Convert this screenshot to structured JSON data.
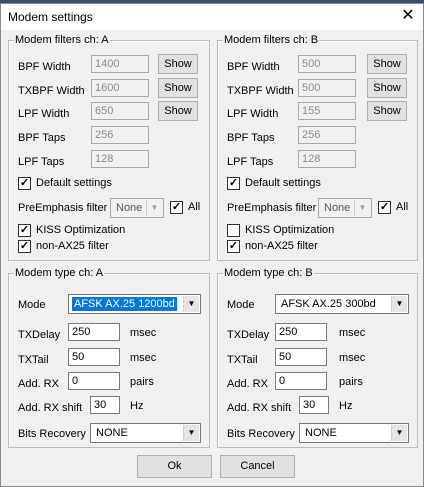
{
  "window": {
    "title": "Modem settings"
  },
  "filters_a": {
    "legend": "Modem filters ch: A",
    "bpf_width_label": "BPF Width",
    "bpf_width": "1400",
    "txbpf_width_label": "TXBPF Width",
    "txbpf_width": "1600",
    "lpf_width_label": "LPF Width",
    "lpf_width": "650",
    "bpf_taps_label": "BPF Taps",
    "bpf_taps": "256",
    "lpf_taps_label": "LPF Taps",
    "lpf_taps": "128",
    "show_label": "Show",
    "default_settings_label": "Default settings",
    "default_settings_checked": true,
    "preemphasis_label": "PreEmphasis filter",
    "preemphasis_value": "None",
    "all_label": "All",
    "all_checked": true,
    "kiss_label": "KISS Optimization",
    "kiss_checked": true,
    "nonax25_label": "non-AX25 filter",
    "nonax25_checked": true
  },
  "filters_b": {
    "legend": "Modem filters ch: B",
    "bpf_width_label": "BPF Width",
    "bpf_width": "500",
    "txbpf_width_label": "TXBPF Width",
    "txbpf_width": "500",
    "lpf_width_label": "LPF Width",
    "lpf_width": "155",
    "bpf_taps_label": "BPF Taps",
    "bpf_taps": "256",
    "lpf_taps_label": "LPF Taps",
    "lpf_taps": "128",
    "show_label": "Show",
    "default_settings_label": "Default settings",
    "default_settings_checked": true,
    "preemphasis_label": "PreEmphasis filter",
    "preemphasis_value": "None",
    "all_label": "All",
    "all_checked": true,
    "kiss_label": "KISS Optimization",
    "kiss_checked": false,
    "nonax25_label": "non-AX25 filter",
    "nonax25_checked": true
  },
  "type_a": {
    "legend": "Modem type ch: A",
    "mode_label": "Mode",
    "mode_value": "AFSK AX.25 1200bd",
    "txdelay_label": "TXDelay",
    "txdelay": "250",
    "txdelay_unit": "msec",
    "txtail_label": "TXTail",
    "txtail": "50",
    "txtail_unit": "msec",
    "addrx_label": "Add. RX",
    "addrx": "0",
    "addrx_unit": "pairs",
    "addrxshift_label": "Add. RX shift",
    "addrxshift": "30",
    "addrxshift_unit": "Hz",
    "bits_label": "Bits Recovery",
    "bits_value": "NONE"
  },
  "type_b": {
    "legend": "Modem type ch: B",
    "mode_label": "Mode",
    "mode_value": "AFSK AX.25 300bd",
    "txdelay_label": "TXDelay",
    "txdelay": "250",
    "txdelay_unit": "msec",
    "txtail_label": "TXTail",
    "txtail": "50",
    "txtail_unit": "msec",
    "addrx_label": "Add. RX",
    "addrx": "0",
    "addrx_unit": "pairs",
    "addrxshift_label": "Add. RX shift",
    "addrxshift": "30",
    "addrxshift_unit": "Hz",
    "bits_label": "Bits Recovery",
    "bits_value": "NONE"
  },
  "footer": {
    "ok_label": "Ok",
    "cancel_label": "Cancel"
  },
  "icons": {
    "close": "close-icon",
    "dropdown": "chevron-down-icon",
    "check": "checkmark-icon"
  },
  "colors": {
    "selection": "#0078d7",
    "face": "#f0f0f0"
  }
}
